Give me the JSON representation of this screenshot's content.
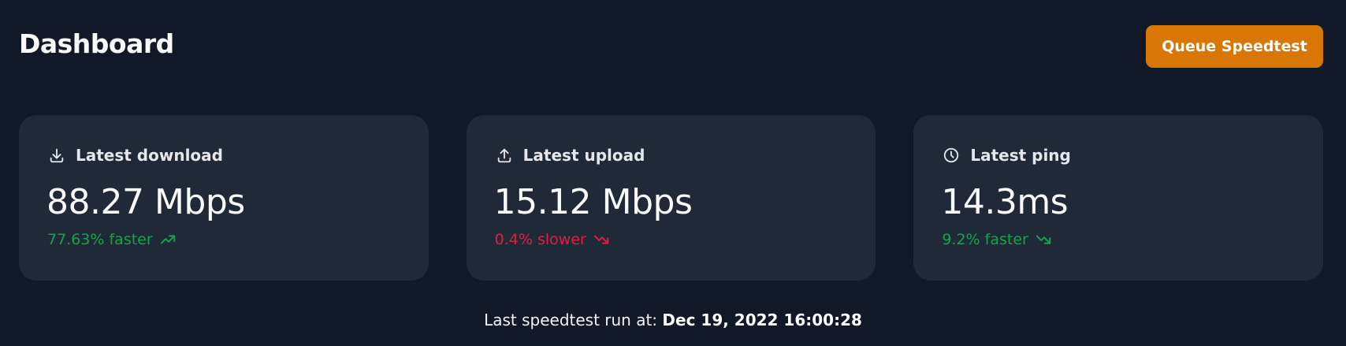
{
  "header": {
    "title": "Dashboard",
    "queue_button_label": "Queue Speedtest",
    "accent_color": "#d97706"
  },
  "cards": [
    {
      "icon": "download-icon",
      "label": "Latest download",
      "value": "88.27 Mbps",
      "delta": "77.63% faster",
      "trend": "up",
      "trend_icon": "trending-up-icon",
      "status_color": "#16a34a"
    },
    {
      "icon": "upload-icon",
      "label": "Latest upload",
      "value": "15.12 Mbps",
      "delta": "0.4% slower",
      "trend": "down",
      "trend_icon": "trending-down-icon",
      "status_color": "#e11d48"
    },
    {
      "icon": "clock-icon",
      "label": "Latest ping",
      "value": "14.3ms",
      "delta": "9.2% faster",
      "trend": "down",
      "trend_icon": "trending-down-icon",
      "status_color": "#16a34a"
    }
  ],
  "footer": {
    "prefix": "Last speedtest run at:",
    "timestamp": "Dec 19, 2022 16:00:28"
  },
  "colors": {
    "background": "#111827",
    "card_background": "#1f2937"
  }
}
